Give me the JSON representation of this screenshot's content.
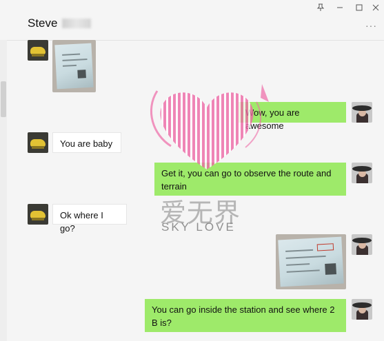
{
  "window": {
    "contact_name": "Steve",
    "pin_icon": "pin-icon",
    "minimize_icon": "minimize-icon",
    "maximize_icon": "maximize-icon",
    "close_icon": "close-icon",
    "more_icon": "more-icon"
  },
  "messages": [
    {
      "sender": "Steve",
      "kind": "image",
      "content": "train-ticket-photo"
    },
    {
      "sender": "me",
      "kind": "text",
      "text": "Wow, you are awesome"
    },
    {
      "sender": "Steve",
      "kind": "text",
      "text": "You are baby"
    },
    {
      "sender": "me",
      "kind": "text",
      "text": "Get it, you can go to observe the route and terrain"
    },
    {
      "sender": "Steve",
      "kind": "text",
      "text": "Ok where I go?"
    },
    {
      "sender": "me",
      "kind": "image",
      "content": "train-ticket-photo"
    },
    {
      "sender": "me",
      "kind": "text",
      "text": "You can go inside the station and see where 2 B is?"
    }
  ],
  "watermark": {
    "chinese": "爱无界",
    "english": "SKY LOVE",
    "heart_color": "#ee6aa7"
  },
  "colors": {
    "outgoing_bubble": "#9eea6a",
    "incoming_bubble": "#ffffff",
    "background": "#f5f5f5"
  }
}
